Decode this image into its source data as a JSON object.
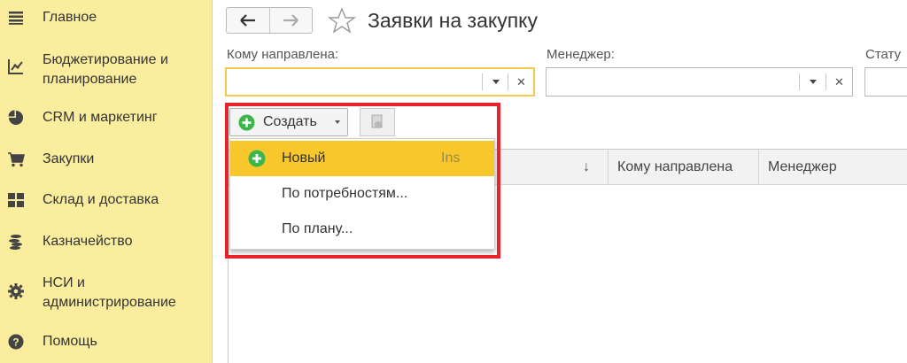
{
  "sidebar": {
    "items": [
      {
        "label": "Главное",
        "icon": "menu-lines-icon"
      },
      {
        "label": "Бюджетирование и планирование",
        "icon": "budget-chart-icon"
      },
      {
        "label": "CRM и маркетинг",
        "icon": "pie-chart-icon"
      },
      {
        "label": "Закупки",
        "icon": "cart-icon"
      },
      {
        "label": "Склад и доставка",
        "icon": "warehouse-grid-icon"
      },
      {
        "label": "Казначейство",
        "icon": "coins-icon"
      },
      {
        "label": "НСИ и администрирование",
        "icon": "gear-icon"
      },
      {
        "label": "Помощь",
        "icon": "help-icon"
      }
    ]
  },
  "header": {
    "title": "Заявки на закупку"
  },
  "filters": {
    "recipient": {
      "label": "Кому направлена:",
      "value": ""
    },
    "manager": {
      "label": "Менеджер:",
      "value": ""
    },
    "status": {
      "label": "Стату"
    }
  },
  "toolbar": {
    "create_label": "Создать"
  },
  "create_menu": {
    "items": [
      {
        "label": "Новый",
        "shortcut": "Ins"
      },
      {
        "label": "По потребностям..."
      },
      {
        "label": "По плану..."
      }
    ]
  },
  "table": {
    "sort_indicator": "↓",
    "columns": [
      "Кому направлена",
      "Менеджер"
    ]
  },
  "colors": {
    "sidebar_bg": "#fbed9e",
    "accent_yellow": "#f7c72c",
    "highlight_red": "#e8232a",
    "create_green": "#3cb54a"
  }
}
